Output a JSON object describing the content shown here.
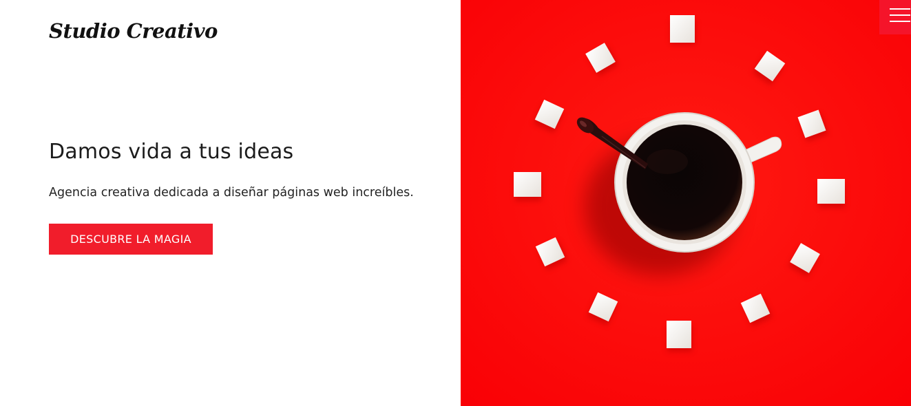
{
  "brand": {
    "logo_text": "Studio Creativo"
  },
  "hero": {
    "headline": "Damos vida a tus ideas",
    "subtitle": "Agencia creativa dedicada a diseñar páginas web increíbles.",
    "cta_label": "DESCUBRE LA MAGIA",
    "image_description_icon": "coffee-clock-image"
  },
  "nav": {
    "menu_icon": "hamburger-menu-icon"
  },
  "colors": {
    "accent": "#f11d2b",
    "hero_background": "#ff0000",
    "text_dark": "#1c1c1c"
  }
}
